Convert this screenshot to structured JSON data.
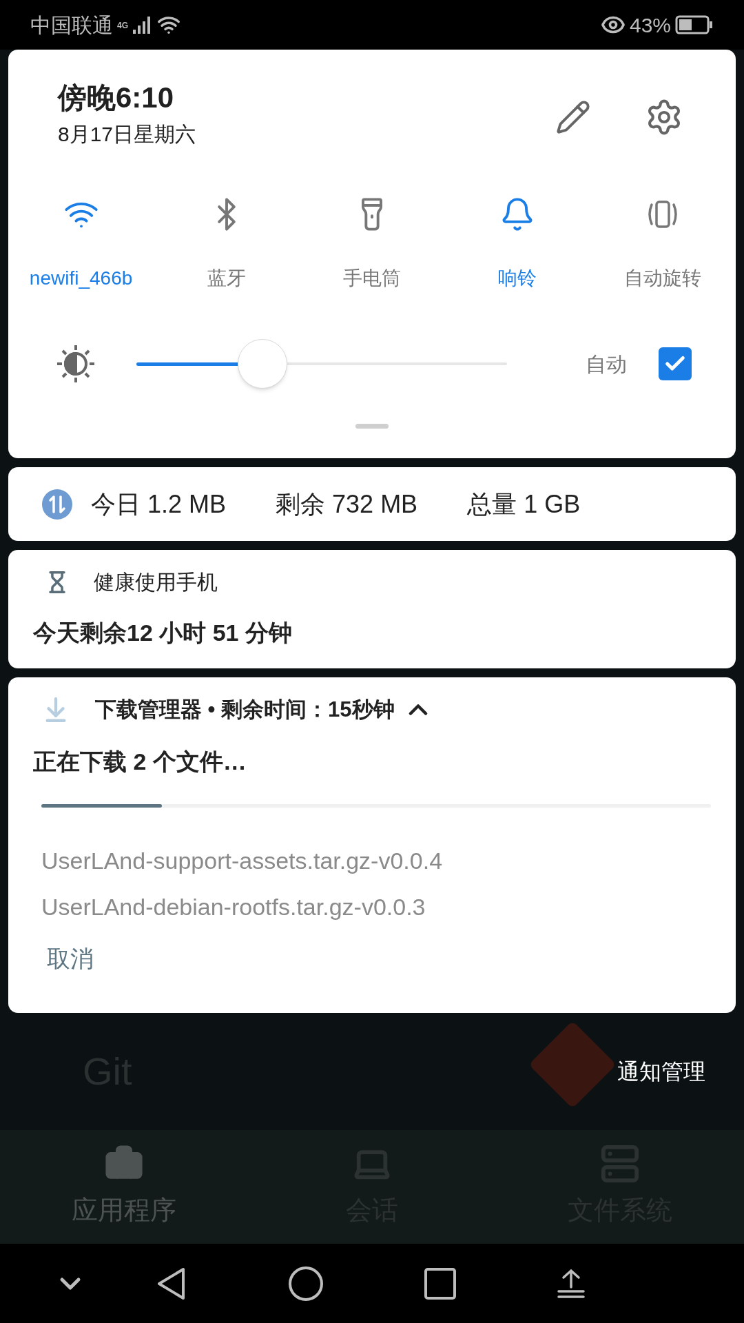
{
  "status_bar": {
    "carrier": "中国联通",
    "network": "4G",
    "battery": "43%"
  },
  "quick_settings": {
    "time": "傍晚6:10",
    "date": "8月17日星期六",
    "tiles": [
      {
        "kind": "wifi",
        "label": "newifi_466b",
        "on": true
      },
      {
        "kind": "bluetooth",
        "label": "蓝牙",
        "on": false
      },
      {
        "kind": "flashlight",
        "label": "手电筒",
        "on": false
      },
      {
        "kind": "ring",
        "label": "响铃",
        "on": true
      },
      {
        "kind": "rotate",
        "label": "自动旋转",
        "on": false
      }
    ],
    "brightness": {
      "level": 0.34,
      "auto_label": "自动",
      "auto_checked": true
    }
  },
  "data_usage": {
    "today": "今日 1.2 MB",
    "remaining": "剩余 732 MB",
    "total": "总量 1 GB"
  },
  "health": {
    "title": "健康使用手机",
    "text": "今天剩余12 小时 51 分钟"
  },
  "download": {
    "header": "下载管理器 • 剩余时间：15秒钟",
    "expanded": true,
    "title": "正在下载 2 个文件…",
    "level": 0.18,
    "files": [
      "UserLAnd-support-assets.tar.gz-v0.0.4",
      "UserLAnd-debian-rootfs.tar.gz-v0.0.3"
    ],
    "action": "取消"
  },
  "background": {
    "title": "Git",
    "manage_button": "通知管理",
    "tabs": [
      {
        "kind": "apps",
        "label": "应用程序",
        "selected": true
      },
      {
        "kind": "sessions",
        "label": "会话",
        "selected": false
      },
      {
        "kind": "files",
        "label": "文件系统",
        "selected": false
      }
    ]
  }
}
